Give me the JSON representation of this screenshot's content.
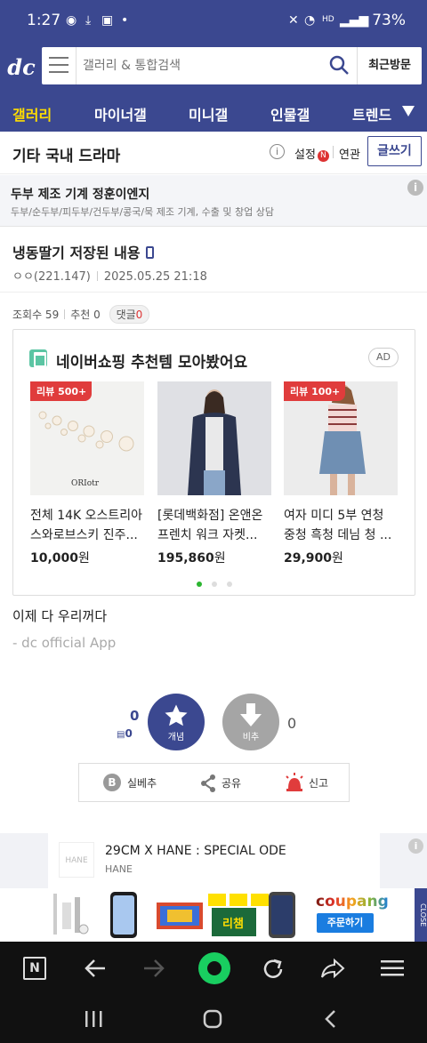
{
  "status_bar": {
    "time": "1:27",
    "battery": "73%",
    "network": "HD"
  },
  "header": {
    "logo": "dc",
    "search_placeholder": "갤러리 & 통합검색",
    "recent_label": "최근방문"
  },
  "nav": {
    "items": [
      "갤러리",
      "마이너갤",
      "미니갤",
      "인물갤",
      "트렌드"
    ]
  },
  "gallery": {
    "title": "기타 국내 드라마",
    "settings_label": "설정",
    "settings_badge": "N",
    "related_label": "연관",
    "write_label": "글쓰기"
  },
  "top_ad": {
    "title": "두부 제조 기계 정훈이엔지",
    "subtitle": "두부/순두부/피두부/건두부/콩국/묵 제조 기계, 수출 및 창업 상담"
  },
  "post": {
    "title": "냉동딸기 저장된 내용",
    "author": "ㅇㅇ(221.147)",
    "date": "2025.05.25 21:18",
    "views_label": "조회수 59",
    "recommend_label": "추천 0",
    "comment_label": "댓글",
    "comment_count": "0",
    "body": "이제 다 우리꺼다",
    "signature": "- dc official App"
  },
  "shopping_ad": {
    "title": "네이버쇼핑 추천템 모아봤어요",
    "ad_tag": "AD",
    "products": [
      {
        "badge": "리뷰 500+",
        "name": "전체 14K 오스트리아 스와로브스키 진주...",
        "price": "10,000",
        "unit": "원",
        "brand_text": "ORIotr"
      },
      {
        "badge": "",
        "name": "[롯데백화점] 온앤온 프렌치 워크 자켓...",
        "price": "195,860",
        "unit": "원"
      },
      {
        "badge": "리뷰 100+",
        "name": "여자 미디 5부 연청 중청 흑청 데님 청 ...",
        "price": "29,900",
        "unit": "원"
      }
    ]
  },
  "votes": {
    "up_label": "개념",
    "up_count": "0",
    "up_sub": "0",
    "down_label": "비추",
    "down_count": "0"
  },
  "actions": {
    "items": [
      "실베추",
      "공유",
      "신고"
    ]
  },
  "bottom_ad": {
    "title": "29CM X HANE : SPECIAL ODE",
    "brand": "HANE",
    "logo_text": "HANE"
  },
  "coupang_ad": {
    "brand": "coupang",
    "button": "주문하기",
    "close": "CLOSE",
    "product_text": "리챔"
  },
  "colors": {
    "primary": "#3b4890",
    "highlight": "#ffdd00",
    "alert": "#e03c3c",
    "green": "#2bb530",
    "toolbar": "#111111"
  }
}
